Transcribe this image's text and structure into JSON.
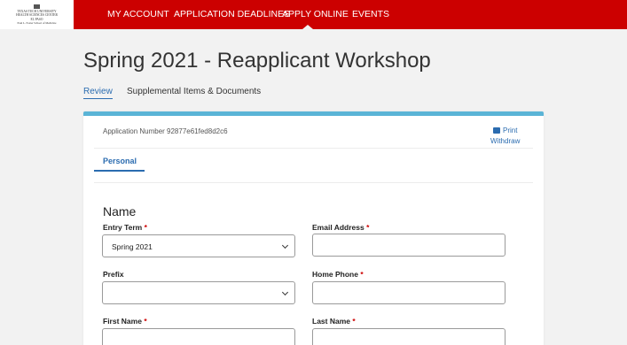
{
  "logo": {
    "lines": [
      "TEXAS TECH UNIVERSITY",
      "HEALTH SCIENCES CENTER",
      "EL PASO",
      "Paul L. Foster School of Medicine"
    ]
  },
  "nav": {
    "items": [
      "MY ACCOUNT",
      "APPLICATION DEADLINES",
      "APPLY ONLINE",
      "EVENTS"
    ]
  },
  "page": {
    "title": "Spring 2021 - Reapplicant Workshop",
    "tabs": [
      "Review",
      "Supplemental Items & Documents"
    ]
  },
  "card": {
    "application_number": "Application Number 92877e61fed8d2c6",
    "print_label": "Print",
    "withdraw_label": "Withdraw",
    "subtab": "Personal"
  },
  "form": {
    "section_title": "Name",
    "required_marker": "*",
    "fields": {
      "entry_term": {
        "label": "Entry Term",
        "value": "Spring 2021"
      },
      "email": {
        "label": "Email Address",
        "value": ""
      },
      "prefix": {
        "label": "Prefix",
        "value": ""
      },
      "home_phone": {
        "label": "Home Phone",
        "value": ""
      },
      "first_name": {
        "label": "First Name",
        "value": ""
      },
      "last_name": {
        "label": "Last Name",
        "value": ""
      }
    }
  },
  "colors": {
    "brand_red": "#cc0000",
    "accent_blue": "#2b6cb0",
    "card_top": "#5ab4d6"
  }
}
